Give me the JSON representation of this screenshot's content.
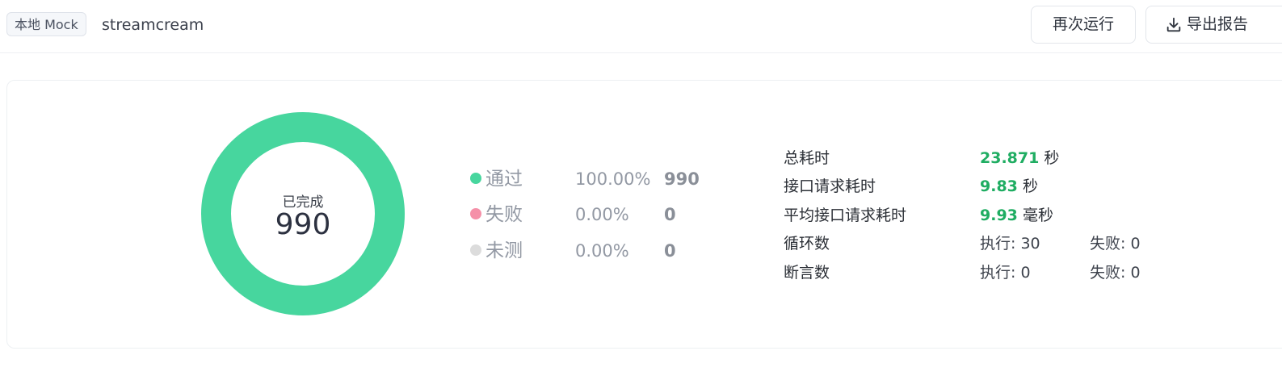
{
  "header": {
    "env_tag": "本地 Mock",
    "project_name": "streamcream",
    "rerun_label": "再次运行",
    "export_label": "导出报告",
    "export_icon": "download-icon"
  },
  "summary": {
    "donut": {
      "label": "已完成",
      "total": "990",
      "pass_fraction": 1.0,
      "pass_color": "#47d69e"
    },
    "legend": [
      {
        "name": "通过",
        "percent": "100.00%",
        "count": "990",
        "color": "#47d69e"
      },
      {
        "name": "失败",
        "percent": "0.00%",
        "count": "0",
        "color": "#f590a8"
      },
      {
        "name": "未测",
        "percent": "0.00%",
        "count": "0",
        "color": "#dcdcdc"
      }
    ],
    "stats": {
      "total_time": {
        "label": "总耗时",
        "value": "23.871",
        "unit": "秒"
      },
      "api_time": {
        "label": "接口请求耗时",
        "value": "9.83",
        "unit": "秒"
      },
      "avg_api_time": {
        "label": "平均接口请求耗时",
        "value": "9.93",
        "unit": "毫秒"
      },
      "loops": {
        "label": "循环数",
        "executed": "执行: 30",
        "failed": "失败: 0"
      },
      "assertions": {
        "label": "断言数",
        "executed": "执行: 0",
        "failed": "失败: 0"
      }
    }
  }
}
